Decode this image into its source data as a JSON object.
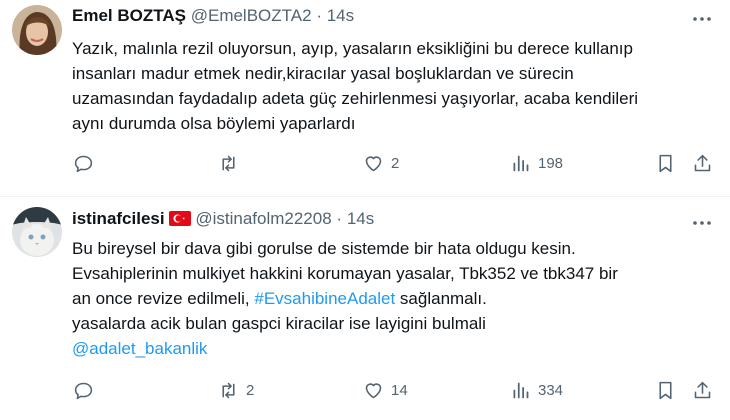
{
  "tweets": [
    {
      "display_name": "Emel BOZTAŞ",
      "handle": "@EmelBOZTA2",
      "separator": "·",
      "time": "14s",
      "lines": [
        "Yazık, malınla rezil oluyorsun, ayıp, yasaların eksikliğini bu derece kullanıp",
        "insanları madur etmek nedir,kiracılar yasal boşluklardan ve sürecin",
        "uzamasından faydadalıp adeta güç zehirlenmesi yaşıyorlar, acaba kendileri",
        "aynı durumda olsa böylemi yaparlardı"
      ],
      "replies": "",
      "reposts": "",
      "likes": "2",
      "views": "198"
    },
    {
      "display_name": "istinafcilesi",
      "flag": "turkey-flag",
      "handle": "@istinafolm22208",
      "separator": "·",
      "time": "14s",
      "line1": "Bu bireysel bir dava gibi gorulse de sistemde bir hata oldugu kesin.",
      "line2": "Evsahiplerinin mulkiyet hakkini korumayan  yasalar,  Tbk352 ve tbk347 bir",
      "line3_before": "an once revize edilmeli, ",
      "hashtag": "#EvsahibineAdalet",
      "line3_after": " sağlanmalı.",
      "line4": "yasalarda acik bulan gaspci kiracilar ise layigini bulmali",
      "mention": "@adalet_bakanlik",
      "replies": "",
      "reposts": "2",
      "likes": "14",
      "views": "334"
    }
  ],
  "colors": {
    "text": "#0f1419",
    "secondary": "#536471",
    "link": "#1d9bf0",
    "divider": "#eff3f4"
  }
}
